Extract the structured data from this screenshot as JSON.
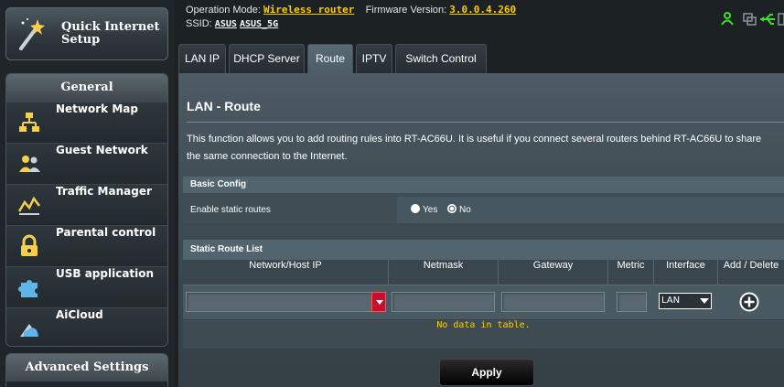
{
  "sidebar": {
    "quick_setup": "Quick Internet Setup",
    "general_header": "General",
    "items": [
      {
        "label": "Network Map",
        "icon": "network-map-icon"
      },
      {
        "label": "Guest Network",
        "icon": "guest-network-icon"
      },
      {
        "label": "Traffic Manager",
        "icon": "traffic-manager-icon"
      },
      {
        "label": "Parental control",
        "icon": "parental-control-icon"
      },
      {
        "label": "USB application",
        "icon": "usb-application-icon"
      },
      {
        "label": "AiCloud",
        "icon": "aicloud-icon"
      }
    ],
    "advanced_header": "Advanced Settings"
  },
  "topbar": {
    "operation_mode_label": "Operation Mode:",
    "operation_mode_value": "Wireless router",
    "firmware_label": "Firmware Version:",
    "firmware_value": "3.0.0.4.260",
    "ssid_label": "SSID:",
    "ssid_1": "ASUS",
    "ssid_2": "ASUS_5G",
    "status_colors": {
      "client": "#3ddc2f",
      "usb": "#3ddc2f"
    }
  },
  "tabs": [
    {
      "label": "LAN IP",
      "active": false
    },
    {
      "label": "DHCP Server",
      "active": false
    },
    {
      "label": "Route",
      "active": true
    },
    {
      "label": "IPTV",
      "active": false
    },
    {
      "label": "Switch Control",
      "active": false
    }
  ],
  "main": {
    "title": "LAN - Route",
    "description_line1": "This function allows you to add routing rules into RT-AC66U. It is useful if you connect several routers behind RT-AC66U to share",
    "description_line2": "the same connection to the Internet.",
    "basic_config": {
      "header": "Basic Config",
      "enable_label": "Enable static routes",
      "options": [
        "Yes",
        "No"
      ],
      "selected": "No"
    },
    "static_route_list": {
      "header": "Static Route List",
      "columns": [
        "Network/Host IP",
        "Netmask",
        "Gateway",
        "Metric",
        "Interface",
        "Add / Delete"
      ],
      "interface_value": "LAN",
      "empty_message": "No data in table."
    },
    "apply_label": "Apply"
  }
}
